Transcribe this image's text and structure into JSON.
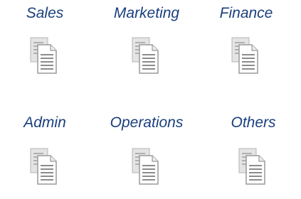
{
  "folders": [
    {
      "label": "Sales",
      "icon": "document-icon"
    },
    {
      "label": "Marketing",
      "icon": "document-icon"
    },
    {
      "label": "Finance",
      "icon": "document-icon"
    },
    {
      "label": "Admin",
      "icon": "document-icon"
    },
    {
      "label": "Operations",
      "icon": "document-icon"
    },
    {
      "label": "Others",
      "icon": "document-icon"
    }
  ],
  "colors": {
    "label": "#1a3f7e",
    "page_back": "#e2e2e2",
    "page_front": "#ffffff",
    "page_border": "#9a9a9a",
    "page_lines": "#8c8c8c"
  }
}
